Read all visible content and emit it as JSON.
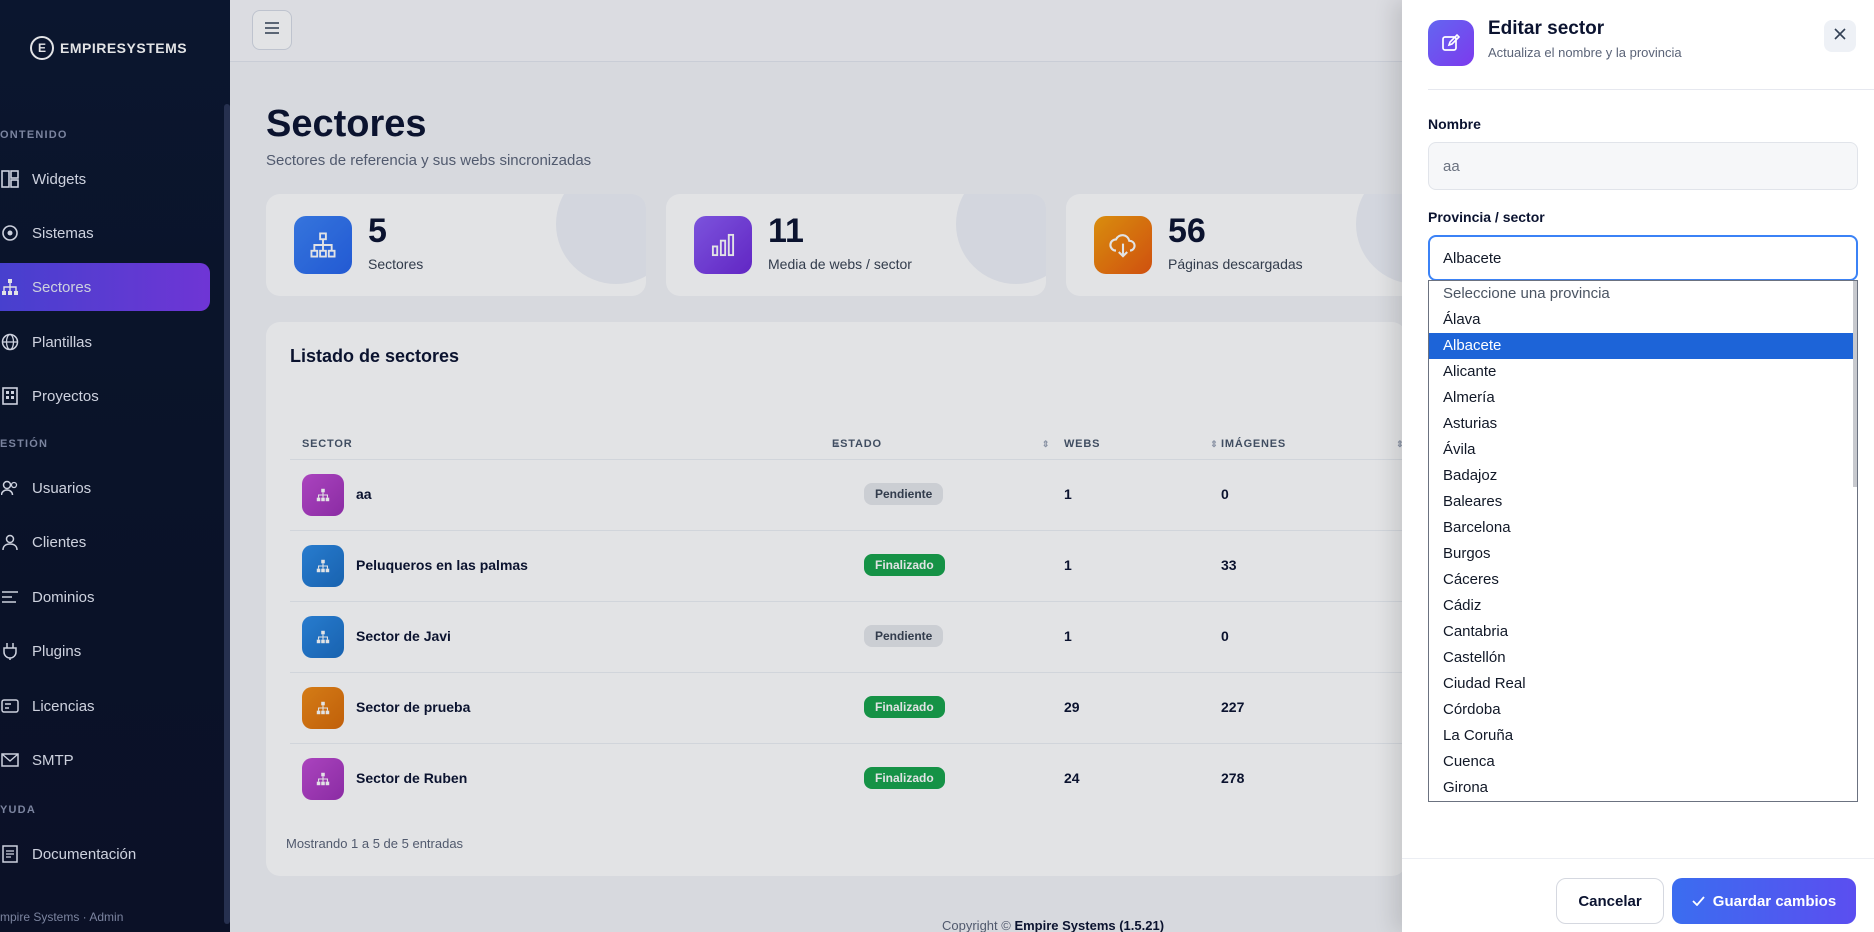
{
  "brand": {
    "logo_text": "EMPIRESYSTEMS"
  },
  "sidebar": {
    "sections": [
      "ONTENIDO",
      "ESTIÓN",
      "YUDA"
    ],
    "items": [
      {
        "label": "Widgets",
        "icon": "widgets-icon"
      },
      {
        "label": "Sistemas",
        "icon": "systems-icon"
      },
      {
        "label": "Sectores",
        "icon": "sitemap-icon",
        "active": true
      },
      {
        "label": "Plantillas",
        "icon": "globe-icon"
      },
      {
        "label": "Proyectos",
        "icon": "building-icon"
      },
      {
        "label": "Usuarios",
        "icon": "users-icon"
      },
      {
        "label": "Clientes",
        "icon": "clients-icon"
      },
      {
        "label": "Dominios",
        "icon": "domains-icon"
      },
      {
        "label": "Plugins",
        "icon": "plug-icon"
      },
      {
        "label": "Licencias",
        "icon": "license-icon"
      },
      {
        "label": "SMTP",
        "icon": "mail-icon"
      },
      {
        "label": "Documentación",
        "icon": "doc-icon"
      }
    ],
    "footer": "mpire Systems · Admin"
  },
  "page": {
    "title": "Sectores",
    "subtitle": "Sectores de referencia y sus webs sincronizadas"
  },
  "stats": [
    {
      "value": "5",
      "label": "Sectores",
      "color": "#2563eb"
    },
    {
      "value": "11",
      "label": "Media de webs / sector",
      "color": "#7c3aed"
    },
    {
      "value": "56",
      "label": "Páginas descargadas",
      "color": "#ea7a0c"
    }
  ],
  "table": {
    "title": "Listado de sectores",
    "headers": [
      "SECTOR",
      "ESTADO",
      "WEBS",
      "IMÁGENES"
    ],
    "rows": [
      {
        "name": "aa",
        "status": "Pendiente",
        "webs": "1",
        "images": "0",
        "color": "#b03bc2"
      },
      {
        "name": "Peluqueros en las palmas",
        "status": "Finalizado",
        "webs": "1",
        "images": "33",
        "color": "#1f7fd6"
      },
      {
        "name": "Sector de Javi",
        "status": "Pendiente",
        "webs": "1",
        "images": "0",
        "color": "#1f7fd6"
      },
      {
        "name": "Sector de prueba",
        "status": "Finalizado",
        "webs": "29",
        "images": "227",
        "color": "#e2780d"
      },
      {
        "name": "Sector de Ruben",
        "status": "Finalizado",
        "webs": "24",
        "images": "278",
        "color": "#b03bc2"
      }
    ],
    "showing": "Mostrando 1 a 5 de 5 entradas"
  },
  "copyright": {
    "prefix": "Copyright ©",
    "brand": "Empire Systems (1.5.21)"
  },
  "drawer": {
    "title": "Editar sector",
    "subtitle": "Actualiza el nombre y la provincia",
    "nombre_label": "Nombre",
    "nombre_value": "aa",
    "provincia_label": "Provincia / sector",
    "provincia_value": "Albacete",
    "options": [
      "Seleccione una provincia",
      "Álava",
      "Albacete",
      "Alicante",
      "Almería",
      "Asturias",
      "Ávila",
      "Badajoz",
      "Baleares",
      "Barcelona",
      "Burgos",
      "Cáceres",
      "Cádiz",
      "Cantabria",
      "Castellón",
      "Ciudad Real",
      "Córdoba",
      "La Coruña",
      "Cuenca",
      "Girona"
    ],
    "cancel_label": "Cancelar",
    "save_label": "Guardar cambios"
  }
}
